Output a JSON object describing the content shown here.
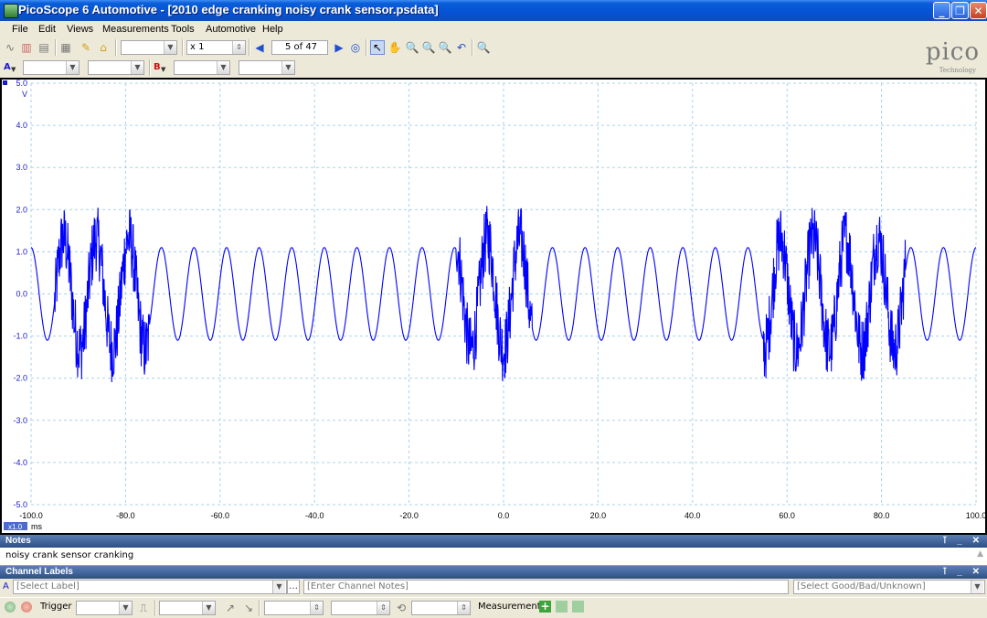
{
  "window": {
    "title": "PicoScope 6 Automotive - [2010 edge cranking noisy crank sensor.psdata]",
    "controls": {
      "minimize": "_",
      "maximize": "❐",
      "close": "✕"
    }
  },
  "menu": [
    "File",
    "Edit",
    "Views",
    "Measurements",
    "Tools",
    "Automotive",
    "Help"
  ],
  "toolbar": {
    "zoom_value": "x 1",
    "buffer_position": "5",
    "buffer_of": "of 47"
  },
  "channels": {
    "a_label": "A",
    "b_label": "B"
  },
  "logo": {
    "text": "pico",
    "subtext": "Technology"
  },
  "scope": {
    "axis_unit_y": "V",
    "axis_unit_x": "ms",
    "zoom_badge": "x1.0",
    "trace_color": "#0000ff",
    "axis_text_color": "#1a1acc"
  },
  "chart_data": {
    "type": "line",
    "x_ticks": [
      "-100.0",
      "-80.0",
      "-60.0",
      "-40.0",
      "-20.0",
      "0.0",
      "20.0",
      "40.0",
      "60.0",
      "80.0",
      "100.0"
    ],
    "y_ticks": [
      "5.0",
      "4.0",
      "3.0",
      "2.0",
      "1.0",
      "0.0",
      "-1.0",
      "-2.0",
      "-3.0",
      "-4.0",
      "-5.0"
    ],
    "xlim": [
      -100,
      100
    ],
    "ylim": [
      -5,
      5
    ],
    "grid": true,
    "signal": {
      "description_free": true,
      "amplitude_v": 1.1,
      "cycles": 29,
      "noise_bursts_ms": [
        [
          -95,
          -75
        ],
        [
          -10,
          6
        ],
        [
          55,
          85
        ]
      ],
      "noise_peak_v": 2.1
    }
  },
  "notes": {
    "title": "Notes",
    "text": "noisy crank sensor cranking"
  },
  "channel_labels": {
    "title": "Channel Labels",
    "channel": "A",
    "select_label": "[Select Label]",
    "channel_notes": "[Enter Channel Notes]",
    "good_bad": "[Select Good/Bad/Unknown]"
  },
  "statusbar": {
    "trigger_label": "Trigger",
    "measurements_label": "Measurements"
  }
}
